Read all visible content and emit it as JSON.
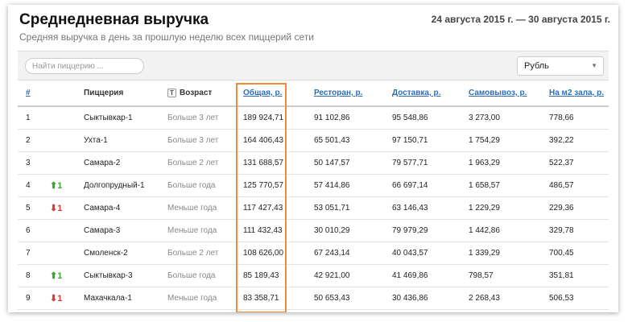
{
  "header": {
    "title": "Среднедневная выручка",
    "subtitle": "Средняя выручка в день за прошлую неделю всех пиццерий сети",
    "date_range": "24 августа 2015 г. — 30 августа 2015 г."
  },
  "toolbar": {
    "search_placeholder": "Найти пиццерию ...",
    "currency_selected": "Рубль"
  },
  "table": {
    "columns": {
      "num": "#",
      "pizzeria": "Пиццерия",
      "age_icon": "T",
      "age": "Возраст",
      "total": "Общая, р.",
      "restaurant": "Ресторан, р.",
      "delivery": "Доставка, р.",
      "pickup": "Самовывоз, р.",
      "per_m2": "На м2 зала, р."
    },
    "rows": [
      {
        "num": "1",
        "move": "",
        "name": "Сыктывкар-1",
        "age": "Больше 3 лет",
        "total": "189 924,71",
        "restaurant": "91 102,86",
        "delivery": "95 548,86",
        "pickup": "3 273,00",
        "per_m2": "778,66"
      },
      {
        "num": "2",
        "move": "",
        "name": "Ухта-1",
        "age": "Больше 3 лет",
        "total": "164 406,43",
        "restaurant": "65 501,43",
        "delivery": "97 150,71",
        "pickup": "1 754,29",
        "per_m2": "392,22"
      },
      {
        "num": "3",
        "move": "",
        "name": "Самара-2",
        "age": "Больше 2 лет",
        "total": "131 688,57",
        "restaurant": "50 147,57",
        "delivery": "79 577,71",
        "pickup": "1 963,29",
        "per_m2": "522,37"
      },
      {
        "num": "4",
        "move": "up",
        "move_label": "1",
        "name": "Долгопрудный-1",
        "age": "Больше года",
        "total": "125 770,57",
        "restaurant": "57 414,86",
        "delivery": "66 697,14",
        "pickup": "1 658,57",
        "per_m2": "486,57"
      },
      {
        "num": "5",
        "move": "down",
        "move_label": "1",
        "name": "Самара-4",
        "age": "Меньше года",
        "total": "117 427,43",
        "restaurant": "53 051,71",
        "delivery": "63 146,43",
        "pickup": "1 229,29",
        "per_m2": "229,36"
      },
      {
        "num": "6",
        "move": "",
        "name": "Самара-3",
        "age": "Меньше года",
        "total": "111 432,43",
        "restaurant": "30 010,29",
        "delivery": "79 979,29",
        "pickup": "1 442,86",
        "per_m2": "329,78"
      },
      {
        "num": "7",
        "move": "",
        "name": "Смоленск-2",
        "age": "Больше 2 лет",
        "total": "108 626,00",
        "restaurant": "67 243,14",
        "delivery": "40 043,57",
        "pickup": "1 339,29",
        "per_m2": "700,45"
      },
      {
        "num": "8",
        "move": "up",
        "move_label": "1",
        "name": "Сыктывкар-3",
        "age": "Больше года",
        "total": "85 189,43",
        "restaurant": "42 921,00",
        "delivery": "41 469,86",
        "pickup": "798,57",
        "per_m2": "351,81"
      },
      {
        "num": "9",
        "move": "down",
        "move_label": "1",
        "name": "Махачкала-1",
        "age": "Меньше года",
        "total": "83 358,71",
        "restaurant": "50 653,43",
        "delivery": "30 436,86",
        "pickup": "2 268,43",
        "per_m2": "506,53"
      }
    ]
  },
  "colors": {
    "accent_link": "#2a6ebb",
    "highlight_border": "#f08a3c",
    "move_up": "#3aa03a",
    "move_down": "#d23b3b"
  }
}
